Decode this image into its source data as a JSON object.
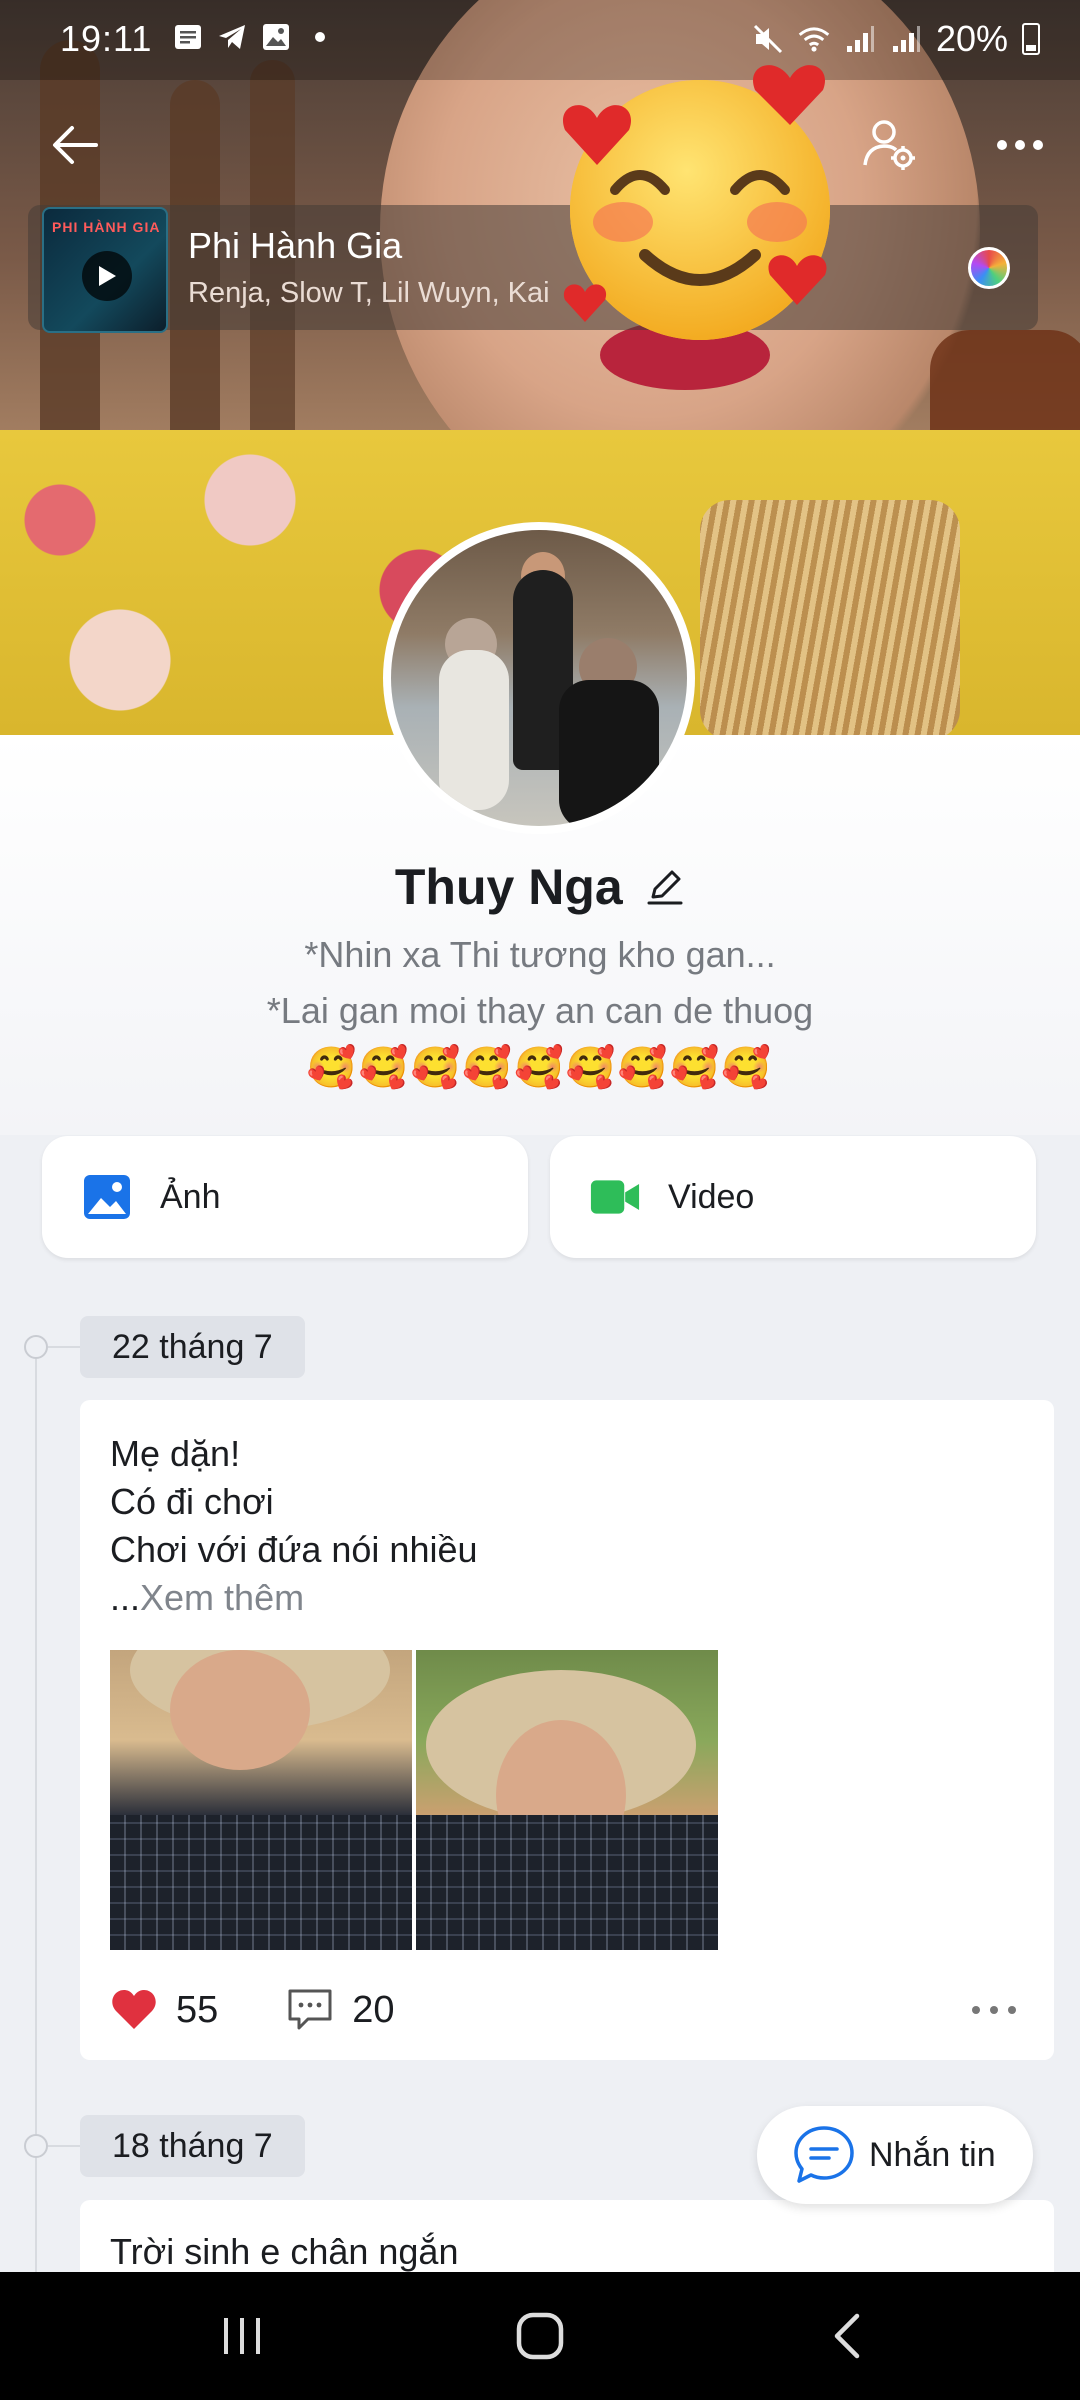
{
  "status_bar": {
    "time": "19:11",
    "battery": "20%"
  },
  "music": {
    "song": "Phi Hành Gia",
    "artists": "Renja, Slow T, Lil Wuyn, Kai",
    "album_caption": "PHI HÀNH GIA"
  },
  "profile": {
    "name": "Thuy Nga",
    "bio_line1": "*Nhin xa Thi tương kho gan...",
    "bio_line2": "*Lai gan moi thay an can de thuog",
    "bio_emojis": "🥰🥰🥰🥰🥰🥰🥰🥰🥰"
  },
  "buttons": {
    "photo_label": "Ảnh",
    "video_label": "Video"
  },
  "posts": [
    {
      "date": "22 tháng 7",
      "line1": "Mẹ dặn!",
      "line2": "Có đi chơi",
      "line3": "Chơi với đứa nói nhiều",
      "see_more_prefix": "...",
      "see_more": "Xem thêm",
      "likes": "55",
      "comments": "20"
    },
    {
      "date": "18 tháng 7",
      "line1": "Trời sinh e chân ngắn"
    }
  ],
  "message_button": {
    "label": "Nhắn tin"
  },
  "colors": {
    "accent_blue": "#1a73e8",
    "video_green": "#2ebd59",
    "like_red": "#e0313f"
  }
}
